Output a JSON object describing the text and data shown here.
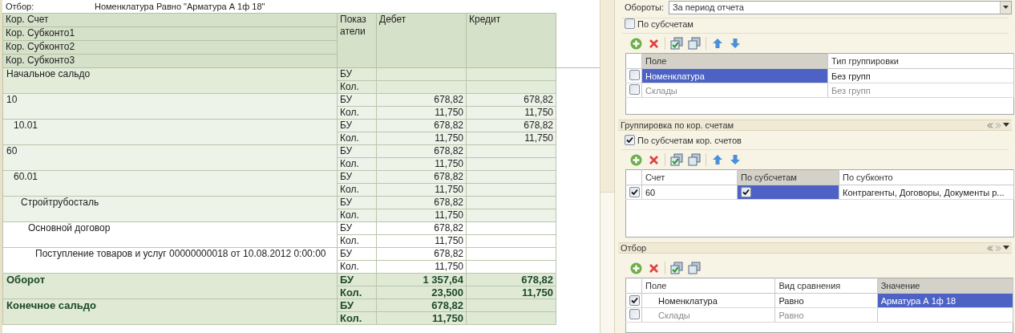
{
  "report": {
    "filter_label": "Отбор:",
    "filter_value": "Номенклатура Равно \"Арматура А 1ф 18\"",
    "header": {
      "row_labels": [
        "Кор. Счет",
        "Кор. Субконто1",
        "Кор. Субконто2",
        "Кор. Субконто3"
      ],
      "indicator": "Показатели",
      "debit": "Дебет",
      "credit": "Кредит"
    },
    "rows": [
      {
        "kind": "opening",
        "label": "Начальное сальдо",
        "lines": [
          {
            "indicator": "БУ"
          },
          {
            "indicator": "Кол."
          }
        ]
      },
      {
        "kind": "account",
        "label": "10",
        "lines": [
          {
            "indicator": "БУ",
            "debit": "678,82",
            "credit": "678,82"
          },
          {
            "indicator": "Кол.",
            "debit": "11,750",
            "credit": "11,750"
          }
        ],
        "children": [
          {
            "kind": "account",
            "label": "10.01",
            "lines": [
              {
                "indicator": "БУ",
                "debit": "678,82",
                "credit": "678,82"
              },
              {
                "indicator": "Кол.",
                "debit": "11,750",
                "credit": "11,750"
              }
            ]
          }
        ]
      },
      {
        "kind": "account",
        "label": "60",
        "lines": [
          {
            "indicator": "БУ",
            "debit": "678,82"
          },
          {
            "indicator": "Кол.",
            "debit": "11,750"
          }
        ],
        "children": [
          {
            "kind": "account",
            "label": "60.01",
            "lines": [
              {
                "indicator": "БУ",
                "debit": "678,82"
              },
              {
                "indicator": "Кол.",
                "debit": "11,750"
              }
            ],
            "children": [
              {
                "kind": "account",
                "label": "Стройтрубосталь",
                "lines": [
                  {
                    "indicator": "БУ",
                    "debit": "678,82"
                  },
                  {
                    "indicator": "Кол.",
                    "debit": "11,750"
                  }
                ],
                "children": [
                  {
                    "kind": "account",
                    "label": "Основной договор",
                    "lines": [
                      {
                        "indicator": "БУ",
                        "debit": "678,82"
                      },
                      {
                        "indicator": "Кол.",
                        "debit": "11,750"
                      }
                    ],
                    "children": [
                      {
                        "kind": "account",
                        "label": "Поступление товаров и услуг 00000000018 от 10.08.2012 0:00:00",
                        "lines": [
                          {
                            "indicator": "БУ",
                            "debit": "678,82"
                          },
                          {
                            "indicator": "Кол.",
                            "debit": "11,750"
                          }
                        ]
                      }
                    ]
                  }
                ]
              }
            ]
          }
        ]
      },
      {
        "kind": "total",
        "label": "Оборот",
        "lines": [
          {
            "indicator": "БУ",
            "debit": "1 357,64",
            "credit": "678,82"
          },
          {
            "indicator": "Кол.",
            "debit": "23,500",
            "credit": "11,750"
          }
        ]
      },
      {
        "kind": "total",
        "label": "Конечное сальдо",
        "lines": [
          {
            "indicator": "БУ",
            "debit": "678,82"
          },
          {
            "indicator": "Кол.",
            "debit": "11,750"
          }
        ]
      }
    ]
  },
  "settings": {
    "turnover": {
      "label": "Обороты:",
      "value": "За период отчета"
    },
    "by_subaccounts": {
      "label": "По субсчетам",
      "checked": false
    },
    "grouping": {
      "move_buttons": true,
      "columns": [
        {
          "label": "Поле",
          "selected": true
        },
        {
          "label": "Тип группировки",
          "selected": false
        }
      ],
      "rows": [
        {
          "checked": false,
          "selected": true,
          "disabled": false,
          "cells": [
            "Номенклатура",
            "Без групп"
          ]
        },
        {
          "checked": false,
          "selected": false,
          "disabled": true,
          "cells": [
            "Склады",
            "Без групп"
          ]
        }
      ]
    },
    "corr_grouping": {
      "title": "Группировка по кор. счетам",
      "option": {
        "label": "По субсчетам кор. счетов",
        "checked": true
      },
      "move_buttons": true,
      "columns": [
        {
          "label": "Счет",
          "selected": false
        },
        {
          "label": "По субсчетам",
          "selected": true
        },
        {
          "label": "По субконто",
          "selected": false
        }
      ],
      "rows": [
        {
          "checked": true,
          "selected": true,
          "disabled": false,
          "account": "60",
          "by_subaccounts": true,
          "by_subconto": "Контрагенты, Договоры, Документы р..."
        }
      ]
    },
    "filter": {
      "title": "Отбор",
      "move_buttons": false,
      "columns": [
        {
          "label": "Поле",
          "selected": false
        },
        {
          "label": "Вид сравнения",
          "selected": false
        },
        {
          "label": "Значение",
          "selected": true
        }
      ],
      "rows": [
        {
          "checked": true,
          "selected": true,
          "disabled": false,
          "cells": [
            "Номенклатура",
            "Равно",
            "Арматура А 1ф 18"
          ]
        },
        {
          "checked": false,
          "selected": false,
          "disabled": true,
          "cells": [
            "Склады",
            "Равно"
          ]
        }
      ]
    }
  }
}
